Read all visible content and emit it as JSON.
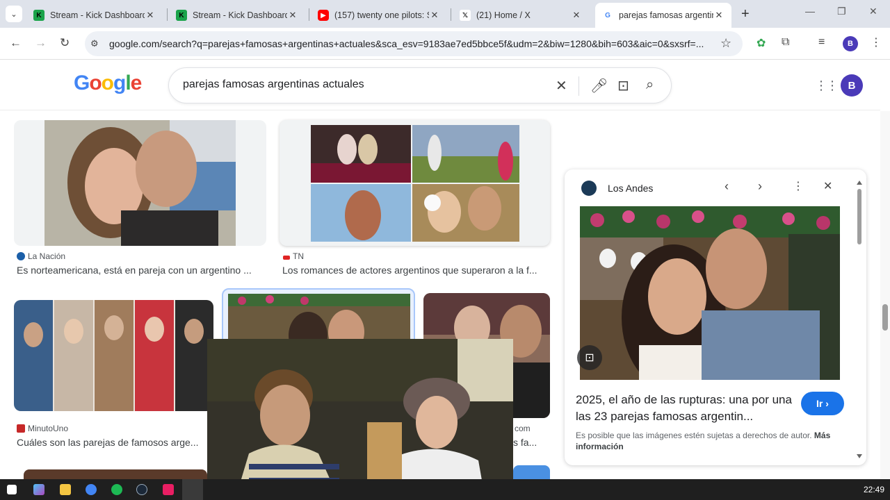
{
  "browser": {
    "tabs": [
      {
        "title": "Stream - Kick Dashboard",
        "icon": "kick-icon",
        "active": false
      },
      {
        "title": "Stream - Kick Dashboard",
        "icon": "kick-icon",
        "active": false
      },
      {
        "title": "(157) twenty one pilots: S",
        "icon": "youtube-icon",
        "active": false
      },
      {
        "title": "(21) Home / X",
        "icon": "x-icon",
        "active": false
      },
      {
        "title": "parejas famosas argentin",
        "icon": "google-icon",
        "active": true
      }
    ],
    "url": "google.com/search?q=parejas+famosas+argentinas+actuales&sca_esv=9183ae7ed5bbce5f&udm=2&biw=1280&bih=603&aic=0&sxsrf=...",
    "profile_initial": "B"
  },
  "google": {
    "logo_letters": [
      "G",
      "o",
      "o",
      "g",
      "l",
      "e"
    ],
    "logo_colors": [
      "#4285f4",
      "#ea4335",
      "#fbbc05",
      "#4285f4",
      "#34a853",
      "#ea4335"
    ],
    "query": "parejas famosas argentinas actuales",
    "profile_initial": "B"
  },
  "results": [
    {
      "source": "La Nación",
      "caption": "Es norteamericana, está en pareja con un argentino ..."
    },
    {
      "source": "TN",
      "caption": "Los romances de actores argentinos que superaron a la f..."
    },
    {
      "source": "MinutoUno",
      "caption": "Cuáles son las parejas de famosos arge..."
    },
    {
      "source": "",
      "caption": ""
    },
    {
      "source": "com",
      "caption": "s fa..."
    }
  ],
  "preview": {
    "source": "Los Andes",
    "title": "2025, el año de las rupturas: una por una las 23 parejas famosas argentin...",
    "button": "Ir",
    "copyright": "Es posible que las imágenes estén sujetas a derechos de autor.",
    "more_info": "Más información"
  },
  "taskbar": {
    "time": "22:49"
  },
  "colors": {
    "accent": "#1a73e8",
    "profile": "#4a3ab8"
  }
}
